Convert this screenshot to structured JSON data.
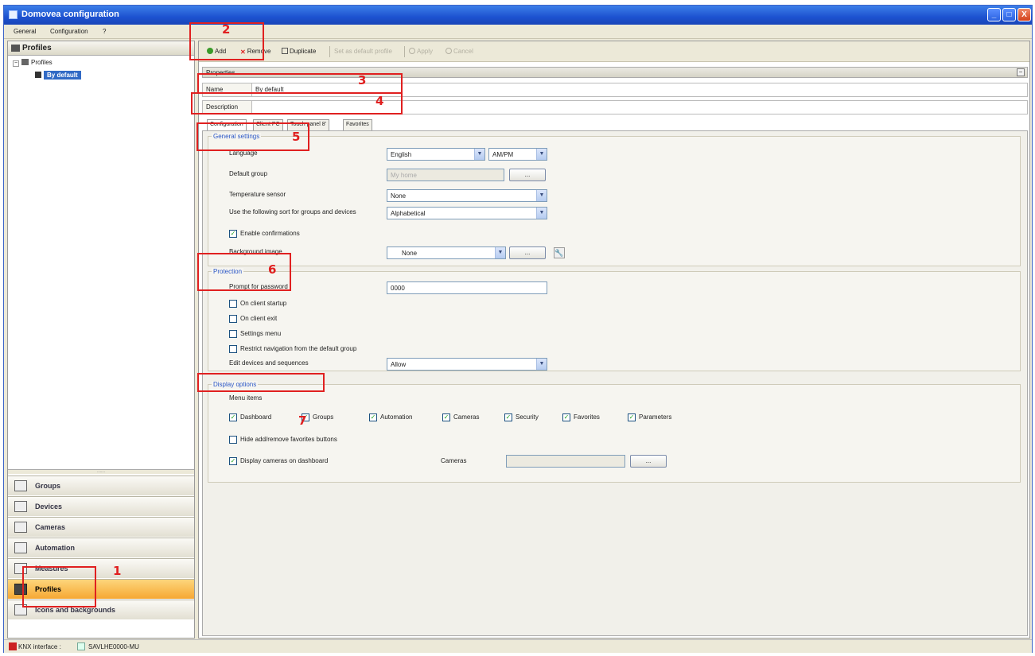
{
  "window": {
    "title": "Domovea configuration",
    "buttons": [
      "_",
      "□",
      "X"
    ]
  },
  "menu": [
    "General",
    "Configuration",
    "?"
  ],
  "left": {
    "header": "Profiles",
    "tree_root": "Profiles",
    "tree_child": "By default",
    "splitter": "......",
    "nav": [
      "Groups",
      "Devices",
      "Cameras",
      "Automation",
      "Measures",
      "Profiles",
      "Icons and backgrounds"
    ]
  },
  "toolbar": {
    "add": "Add",
    "remove": "Remove",
    "duplicate": "Duplicate",
    "set_default": "Set as default profile",
    "apply": "Apply",
    "cancel": "Cancel"
  },
  "properties": {
    "header": "Properties",
    "name_label": "Name",
    "name_value": "By default",
    "description_label": "Description",
    "description_value": ""
  },
  "tabs": [
    "Configuration",
    "Client PC",
    "Touch panel 8'",
    "Favorites"
  ],
  "general": {
    "title": "General settings",
    "language_label": "Language",
    "language_value": "English",
    "time_format": "AM/PM",
    "default_group_label": "Default group",
    "default_group_value": "My home",
    "browse": "...",
    "temperature_label": "Temperature sensor",
    "temperature_value": "None",
    "sort_label": "Use the following sort for groups and devices",
    "sort_value": "Alphabetical",
    "enable_confirmations": "Enable confirmations",
    "background_label": "Background image",
    "background_value": "None"
  },
  "protection": {
    "title": "Protection",
    "prompt_label": "Prompt for password",
    "prompt_value": "0000",
    "on_startup": "On client startup",
    "on_exit": "On client exit",
    "settings_menu": "Settings menu",
    "restrict_nav": "Restrict navigation from the default group",
    "edit_label": "Edit devices and sequences",
    "edit_value": "Allow"
  },
  "display": {
    "title": "Display options",
    "menu_items_label": "Menu items",
    "items": [
      "Dashboard",
      "Groups",
      "Automation",
      "Cameras",
      "Security",
      "Favorites",
      "Parameters"
    ],
    "hide_favorites": "Hide add/remove favorites buttons",
    "display_cameras": "Display cameras on dashboard",
    "cameras_label": "Cameras",
    "browse": "..."
  },
  "annotations": [
    "1",
    "2",
    "3",
    "4",
    "5",
    "6",
    "7"
  ],
  "status": {
    "interface": "KNX interface :",
    "server": "SAVLHE0000-MU"
  }
}
